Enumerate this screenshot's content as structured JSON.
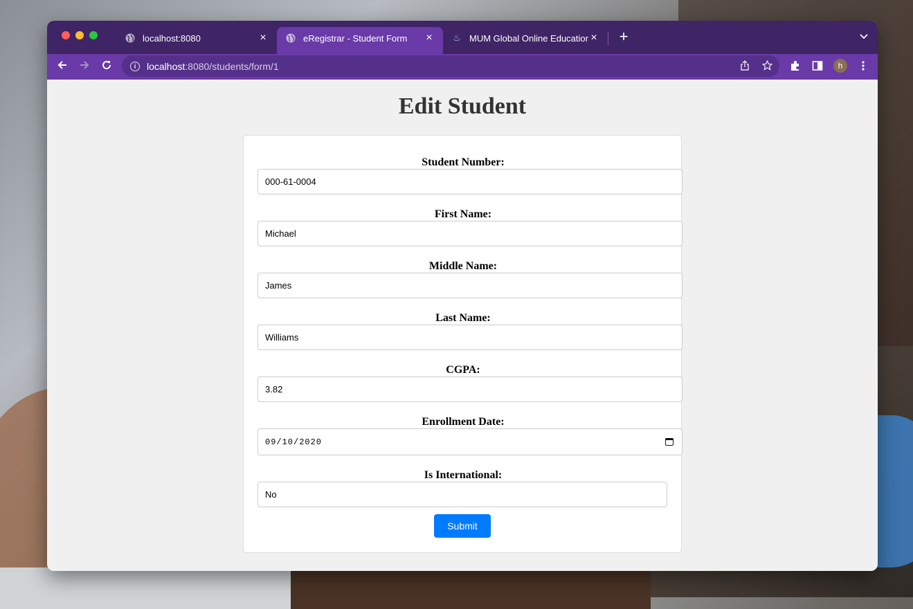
{
  "browser": {
    "tabs": [
      {
        "title": "localhost:8080",
        "active": false
      },
      {
        "title": "eRegistrar - Student Form",
        "active": true
      },
      {
        "title": "MUM Global Online Education :",
        "active": false
      }
    ],
    "url_host": "localhost",
    "url_path": ":8080/students/form/1",
    "profile_initial": "h"
  },
  "page": {
    "title": "Edit Student",
    "form": {
      "student_number_label": "Student Number:",
      "student_number_value": "000-61-0004",
      "first_name_label": "First Name:",
      "first_name_value": "Michael",
      "middle_name_label": "Middle Name:",
      "middle_name_value": "James",
      "last_name_label": "Last Name:",
      "last_name_value": "Williams",
      "cgpa_label": "CGPA:",
      "cgpa_value": "3.82",
      "enrollment_date_label": "Enrollment Date:",
      "enrollment_date_value": "09/10/2020",
      "is_international_label": "Is International:",
      "is_international_value": "No",
      "submit_label": "Submit"
    }
  },
  "colors": {
    "tabbar": "#3f2466",
    "toolbar": "#6a3aa8",
    "submit": "#007bff"
  }
}
